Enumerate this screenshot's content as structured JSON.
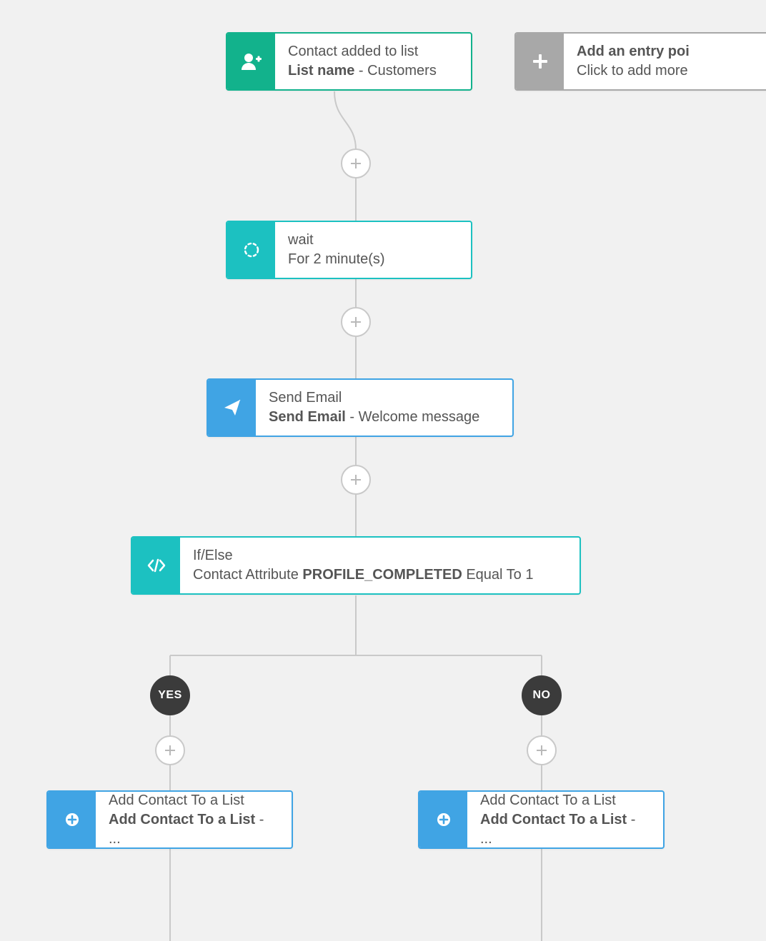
{
  "colors": {
    "green": "#12b28c",
    "gray": "#a8a8a8",
    "teal": "#1cc1c1",
    "blue": "#40a4e4",
    "connector": "#c9c9c9",
    "dark": "#3b3b3b"
  },
  "entry": {
    "title": "Contact added to list",
    "sub_label": "List name",
    "sub_value": " - Customers"
  },
  "add_entry": {
    "title": "Add an entry poi",
    "subtitle": "Click to add more"
  },
  "wait": {
    "title": "wait",
    "subtitle": "For 2 minute(s)"
  },
  "send_email": {
    "title": "Send Email",
    "sub_label": "Send Email",
    "sub_value": " - Welcome message"
  },
  "if_else": {
    "title": "If/Else",
    "sub_prefix": "Contact Attribute ",
    "sub_bold": "PROFILE_COMPLETED",
    "sub_suffix": " Equal To 1"
  },
  "branches": {
    "yes": "YES",
    "no": "NO"
  },
  "add_to_list": {
    "title": "Add Contact To a List",
    "sub_label": "Add Contact To a List",
    "sub_value": " - ..."
  },
  "plus": "+"
}
